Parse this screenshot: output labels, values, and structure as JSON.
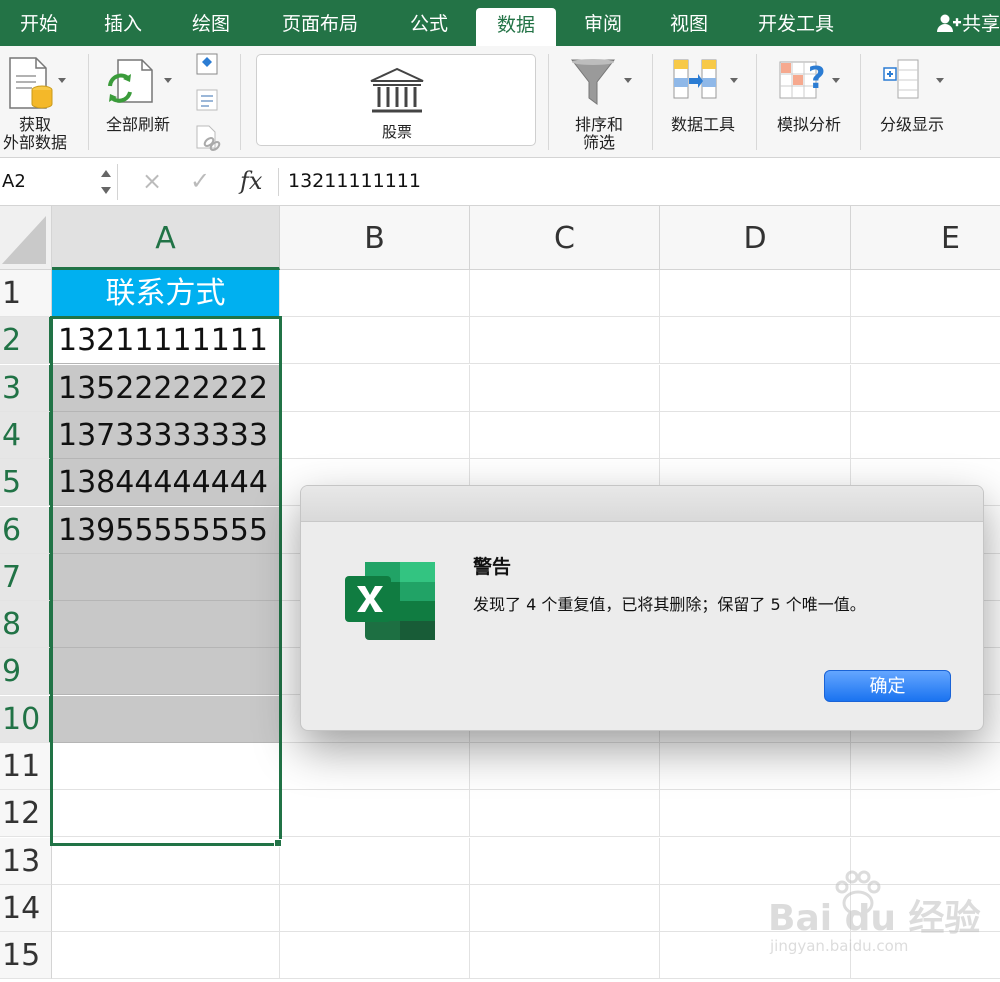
{
  "ribbon_tabs": [
    "开始",
    "插入",
    "绘图",
    "页面布局",
    "公式",
    "数据",
    "审阅",
    "视图",
    "开发工具"
  ],
  "active_tab": "数据",
  "share_label": "共享",
  "ribbon_groups": {
    "get_external_data": "获取\n外部数据",
    "refresh_all": "全部刷新",
    "stocks": "股票",
    "sort_filter": "排序和\n筛选",
    "data_tools": "数据工具",
    "what_if": "模拟分析",
    "outline": "分级显示"
  },
  "formula_bar": {
    "name_box": "A2",
    "cancel_icon": "×",
    "enter_icon": "✓",
    "fx_label": "fx",
    "value": "13211111111"
  },
  "columns": [
    "A",
    "B",
    "C",
    "D",
    "E"
  ],
  "rows": [
    "1",
    "2",
    "3",
    "4",
    "5",
    "6",
    "7",
    "8",
    "9",
    "10",
    "11",
    "12",
    "13",
    "14",
    "15"
  ],
  "cells": {
    "A1": "联系方式",
    "A2": "13211111111",
    "A3": "13522222222",
    "A4": "13733333333",
    "A5": "13844444444",
    "A6": "13955555555"
  },
  "dialog": {
    "title": "警告",
    "message": "发现了 4 个重复值，已将其删除；保留了 5 个唯一值。",
    "ok_button": "确定",
    "app_icon": "excel-icon"
  },
  "watermark": {
    "text": "Bai du 经验",
    "sub": "jingyan.baidu.com"
  },
  "colors": {
    "excel_green": "#217346",
    "header_fill": "#00b0f0",
    "selection_gray": "#c8c8c8",
    "ok_blue": "#1a73f0"
  }
}
